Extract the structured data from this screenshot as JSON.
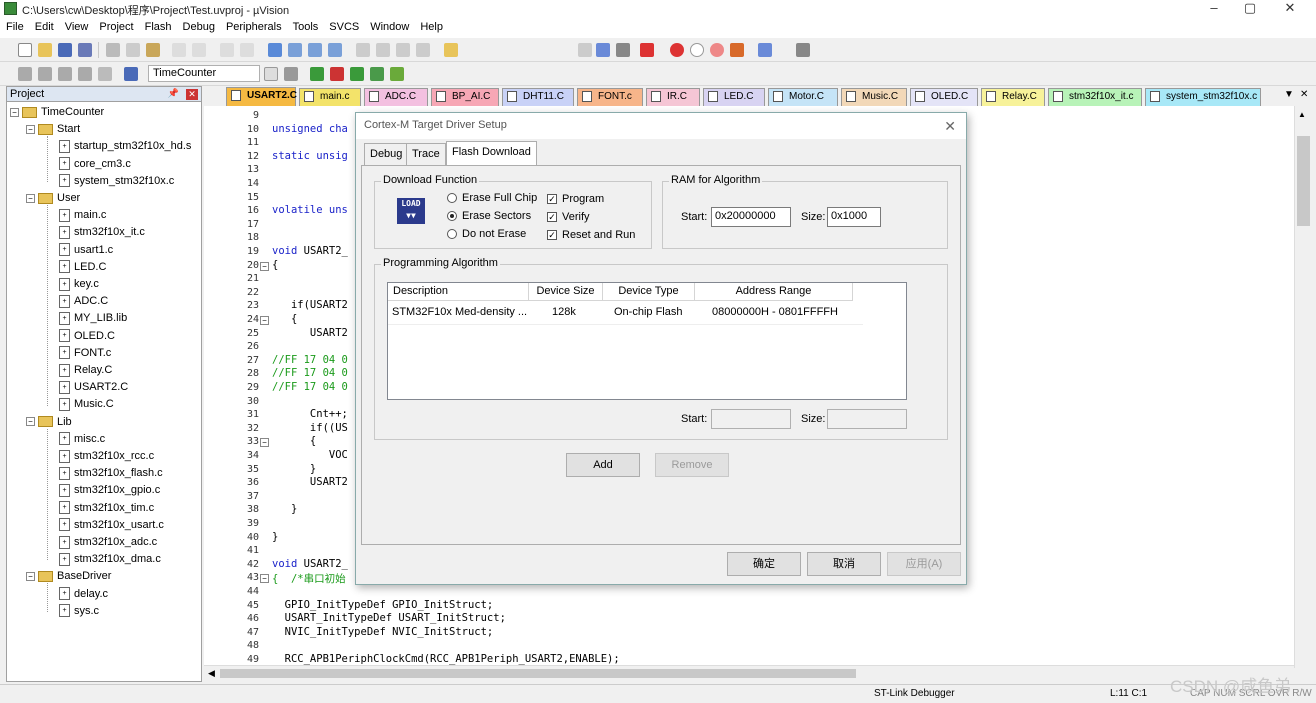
{
  "window": {
    "title": "C:\\Users\\cw\\Desktop\\程序\\Project\\Test.uvproj - µVision"
  },
  "menu": [
    "File",
    "Edit",
    "View",
    "Project",
    "Flash",
    "Debug",
    "Peripherals",
    "Tools",
    "SVCS",
    "Window",
    "Help"
  ],
  "toolbar2": {
    "target": "TimeCounter"
  },
  "project": {
    "title": "Project",
    "root": "TimeCounter",
    "groups": [
      {
        "name": "Start",
        "files": [
          "startup_stm32f10x_hd.s",
          "core_cm3.c",
          "system_stm32f10x.c"
        ]
      },
      {
        "name": "User",
        "files": [
          "main.c",
          "stm32f10x_it.c",
          "usart1.c",
          "LED.C",
          "key.c",
          "ADC.C",
          "MY_LIB.lib",
          "OLED.C",
          "FONT.c",
          "Relay.C",
          "USART2.C",
          "Music.C"
        ]
      },
      {
        "name": "Lib",
        "files": [
          "misc.c",
          "stm32f10x_rcc.c",
          "stm32f10x_flash.c",
          "stm32f10x_gpio.c",
          "stm32f10x_tim.c",
          "stm32f10x_usart.c",
          "stm32f10x_adc.c",
          "stm32f10x_dma.c"
        ]
      },
      {
        "name": "BaseDriver",
        "files": [
          "delay.c",
          "sys.c"
        ]
      }
    ]
  },
  "tabs": [
    {
      "label": "USART2.C",
      "color": "#f5b942"
    },
    {
      "label": "main.c",
      "color": "#f3e36a"
    },
    {
      "label": "ADC.C",
      "color": "#f3c0e0"
    },
    {
      "label": "BP_AI.C",
      "color": "#f7a7b5"
    },
    {
      "label": "DHT11.C",
      "color": "#c9d2f7"
    },
    {
      "label": "FONT.c",
      "color": "#f7b58a"
    },
    {
      "label": "IR.C",
      "color": "#f5c6d5"
    },
    {
      "label": "LED.C",
      "color": "#d8d3f2"
    },
    {
      "label": "Motor.C",
      "color": "#c5e4f7"
    },
    {
      "label": "Music.C",
      "color": "#f2d8b8"
    },
    {
      "label": "OLED.C",
      "color": "#e4e4f7"
    },
    {
      "label": "Relay.C",
      "color": "#f7f29a"
    },
    {
      "label": "stm32f10x_it.c",
      "color": "#b8f3b8"
    },
    {
      "label": "system_stm32f10x.c",
      "color": "#a8e8f7"
    }
  ],
  "editor": {
    "line_numbers": [
      "9",
      "10",
      "11",
      "12",
      "13",
      "14",
      "15",
      "16",
      "17",
      "18",
      "19",
      "20",
      "21",
      "22",
      "23",
      "24",
      "25",
      "26",
      "27",
      "28",
      "29",
      "30",
      "31",
      "32",
      "33",
      "34",
      "35",
      "36",
      "37",
      "38",
      "39",
      "40",
      "41",
      "42",
      "43",
      "44",
      "45",
      "46",
      "47",
      "48",
      "49"
    ],
    "lines": [
      {
        "n": 10,
        "text": "unsigned cha",
        "cls": "kw"
      },
      {
        "n": 12,
        "text": "static unsig",
        "cls": "kw"
      },
      {
        "n": 16,
        "text": "volatile uns",
        "cls": "kw"
      },
      {
        "n": 19,
        "text": "void USART2_",
        "cls": "mix"
      },
      {
        "n": 20,
        "text": "{",
        "cls": ""
      },
      {
        "n": 23,
        "text": "   if(USART2",
        "cls": ""
      },
      {
        "n": 24,
        "text": "   {",
        "cls": ""
      },
      {
        "n": 25,
        "text": "      USART2",
        "cls": ""
      },
      {
        "n": 27,
        "text": "//FF 17 04 0",
        "cls": "cm"
      },
      {
        "n": 28,
        "text": "//FF 17 04 0",
        "cls": "cm"
      },
      {
        "n": 29,
        "text": "//FF 17 04 0",
        "cls": "cm"
      },
      {
        "n": 31,
        "text": "      Cnt++;",
        "cls": ""
      },
      {
        "n": 32,
        "text": "      if((US",
        "cls": ""
      },
      {
        "n": 33,
        "text": "      {",
        "cls": ""
      },
      {
        "n": 34,
        "text": "         VOC",
        "cls": ""
      },
      {
        "n": 35,
        "text": "      }",
        "cls": ""
      },
      {
        "n": 36,
        "text": "      USART2",
        "cls": ""
      },
      {
        "n": 38,
        "text": "   }",
        "cls": ""
      },
      {
        "n": 40,
        "text": "}",
        "cls": ""
      },
      {
        "n": 42,
        "text": "void USART2_",
        "cls": "mix"
      },
      {
        "n": 43,
        "text": "{  /*串口初始",
        "cls": "cm"
      },
      {
        "n": 45,
        "text": "  GPIO_InitTypeDef GPIO_InitStruct;",
        "cls": ""
      },
      {
        "n": 46,
        "text": "  USART_InitTypeDef USART_InitStruct;",
        "cls": ""
      },
      {
        "n": 47,
        "text": "  NVIC_InitTypeDef NVIC_InitStruct;",
        "cls": ""
      },
      {
        "n": 49,
        "text": "  RCC_APB1PeriphClockCmd(RCC_APB1Periph_USART2,ENABLE);",
        "cls": ""
      }
    ]
  },
  "dialog": {
    "title": "Cortex-M Target Driver Setup",
    "tabs": [
      "Debug",
      "Trace",
      "Flash Download"
    ],
    "download_function": {
      "label": "Download Function",
      "icon_text": "LOAD",
      "radios": [
        "Erase Full Chip",
        "Erase Sectors",
        "Do not Erase"
      ],
      "selected_radio": "Erase Sectors",
      "checks": [
        "Program",
        "Verify",
        "Reset and Run"
      ]
    },
    "ram": {
      "label": "RAM for Algorithm",
      "start_label": "Start:",
      "start": "0x20000000",
      "size_label": "Size:",
      "size": "0x1000"
    },
    "algo": {
      "label": "Programming Algorithm",
      "columns": [
        "Description",
        "Device Size",
        "Device Type",
        "Address Range"
      ],
      "rows": [
        {
          "desc": "STM32F10x Med-density ...",
          "size": "128k",
          "type": "On-chip Flash",
          "range": "08000000H - 0801FFFFH"
        }
      ],
      "start_label": "Start:",
      "size_label": "Size:"
    },
    "add": "Add",
    "remove": "Remove",
    "ok": "确定",
    "cancel": "取消",
    "apply": "应用(A)"
  },
  "status": {
    "debugger": "ST-Link Debugger",
    "position": "L:11 C:1",
    "caps": "CAP NUM SCRL OVR R/W"
  },
  "watermark": "CSDN @咸鱼弟"
}
